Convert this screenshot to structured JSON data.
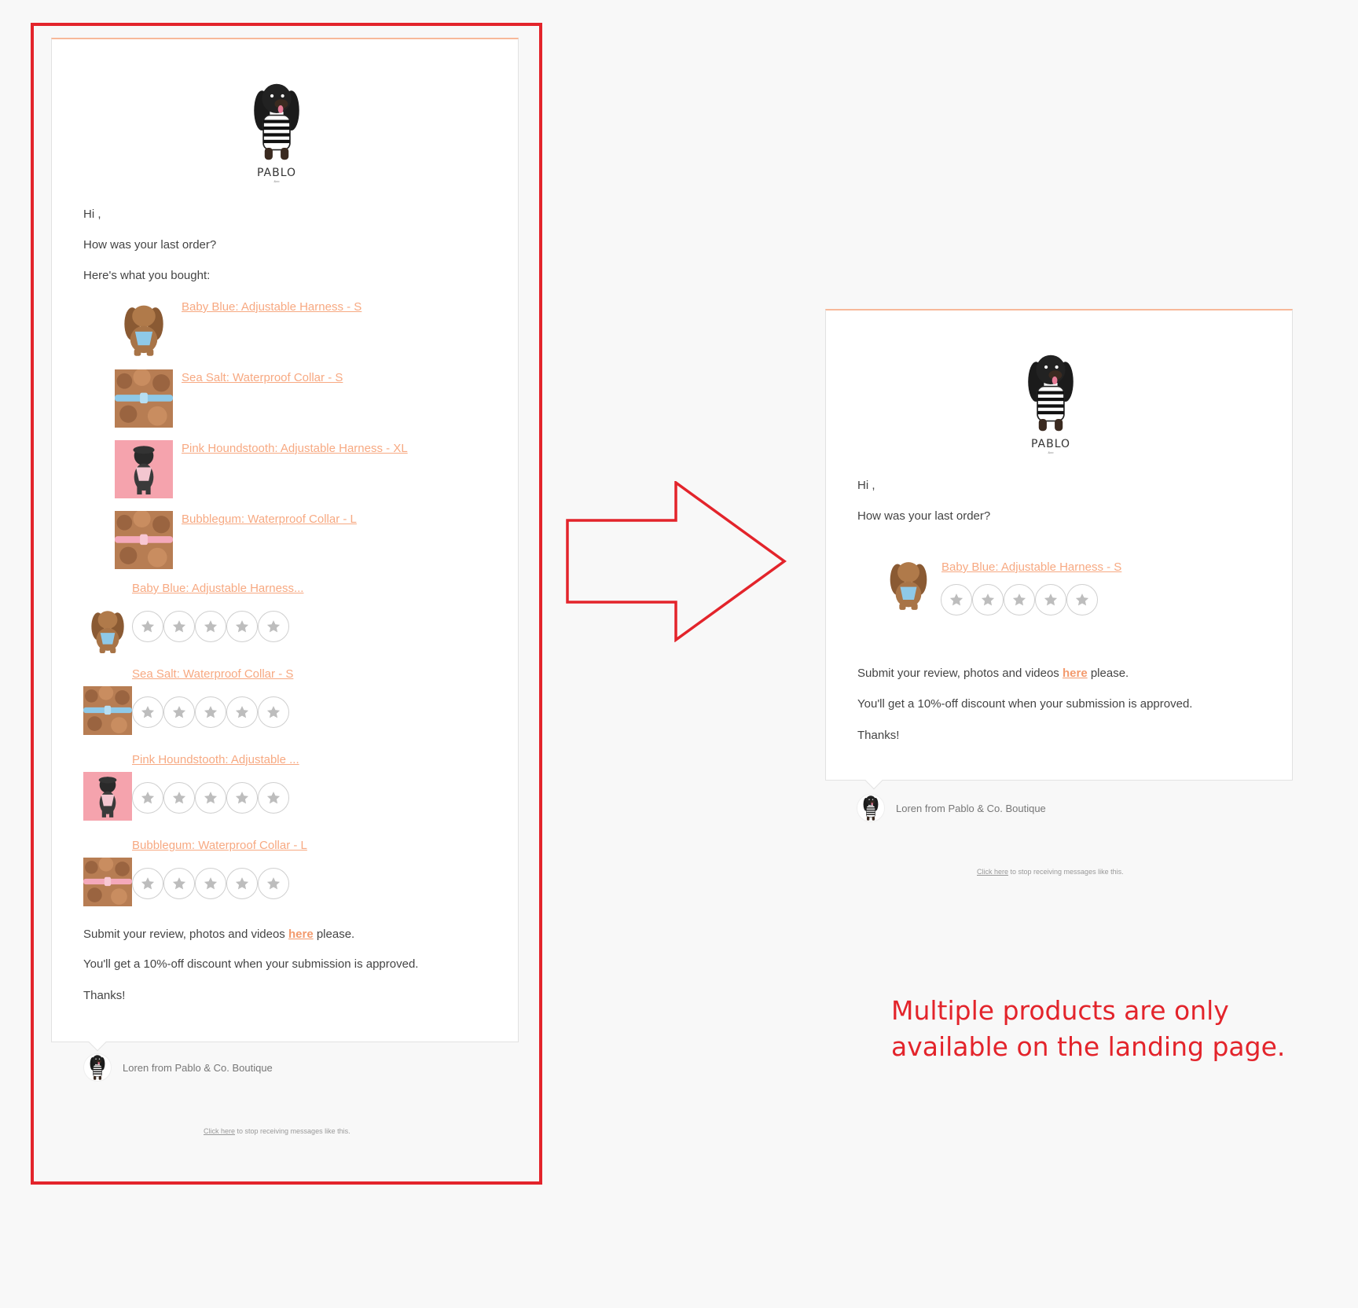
{
  "colors": {
    "annotation": "#e3242b",
    "link": "#f7a982",
    "card_top_border": "#f7b899",
    "background": "#f8f8f8"
  },
  "brand": {
    "logo_word": "PABLO",
    "logo_sub": "&co"
  },
  "left_email": {
    "greeting": "Hi ,",
    "question": "How was your last order?",
    "bought_intro": "Here's what you bought:",
    "purchased_items": [
      {
        "label": "Baby Blue: Adjustable Harness - S",
        "image": "dog-blue-harness"
      },
      {
        "label": "Sea Salt: Waterproof Collar - S",
        "image": "dog-blue-collar"
      },
      {
        "label": "Pink Houndstooth: Adjustable Harness - XL",
        "image": "dog-pink-harness"
      },
      {
        "label": "Bubblegum: Waterproof Collar - L",
        "image": "dog-pink-collar"
      }
    ],
    "review_items": [
      {
        "label": "Baby Blue: Adjustable Harness...",
        "image": "dog-blue-harness",
        "stars": 5
      },
      {
        "label": "Sea Salt: Waterproof Collar - S",
        "image": "dog-blue-collar",
        "stars": 5
      },
      {
        "label": "Pink Houndstooth: Adjustable ...",
        "image": "dog-pink-harness",
        "stars": 5
      },
      {
        "label": "Bubblegum: Waterproof Collar - L",
        "image": "dog-pink-collar",
        "stars": 5
      }
    ],
    "submit_prefix": "Submit your review, photos and videos ",
    "submit_link": "here",
    "submit_suffix": " please.",
    "discount": "You'll get a 10%-off discount when your submission is approved.",
    "thanks": "Thanks!",
    "sender": "Loren from Pablo & Co. Boutique",
    "unsub_link": "Click here",
    "unsub_text": " to stop receiving messages like this."
  },
  "right_email": {
    "greeting": "Hi ,",
    "question": "How was your last order?",
    "review_item": {
      "label": "Baby Blue: Adjustable Harness - S",
      "image": "dog-blue-harness",
      "stars": 5
    },
    "submit_prefix": "Submit your review, photos and videos ",
    "submit_link": "here",
    "submit_suffix": " please.",
    "discount": "You'll get a 10%-off discount when your submission is approved.",
    "thanks": "Thanks!",
    "sender": "Loren from Pablo & Co. Boutique",
    "unsub_link": "Click here",
    "unsub_text": " to stop receiving messages like this."
  },
  "annotation": {
    "line1": "Multiple products are only",
    "line2": "available on the landing page."
  }
}
